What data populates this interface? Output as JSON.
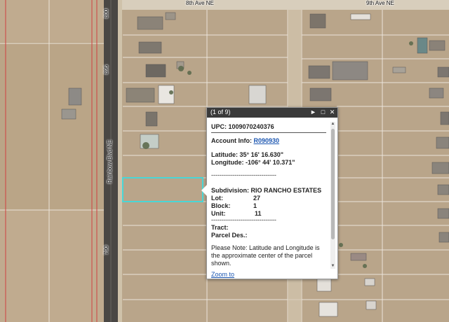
{
  "map": {
    "street_labels": {
      "eighth_ave_left": "8th Ave NE",
      "eighth_ave_right": "9th Ave NE",
      "rainbow_blvd": "Rainbow Blvd NE"
    },
    "address_labels": [
      "800",
      "895",
      "790"
    ],
    "highlight_color": "#49d6d6"
  },
  "popup": {
    "count": "(1 of 9)",
    "icons": {
      "next": "next-arrow-icon",
      "maximize": "maximize-icon",
      "close": "close-icon"
    },
    "upc_label": "UPC:",
    "upc_value": "1009070240376",
    "account_label": "Account Info:",
    "account_link": "R090930",
    "latitude_label": "Latitude:",
    "latitude_value": "35° 16' 16.630\"",
    "longitude_label": "Longitude:",
    "longitude_value": "-106° 44' 10.371\"",
    "dashes": "-------------------------------",
    "subdivision_label": "Subdivision:",
    "subdivision_value": "RIO RANCHO ESTATES",
    "lot_label": "Lot:",
    "lot_value": "27",
    "block_label": "Block:",
    "block_value": "1",
    "unit_label": "Unit:",
    "unit_value": "11",
    "tract_label": "Tract:",
    "parcel_label": "Parcel Des.:",
    "note": "Please Note: Latitude and Longitude is the approximate center of the parcel shown.",
    "zoom_link": "Zoom to"
  }
}
